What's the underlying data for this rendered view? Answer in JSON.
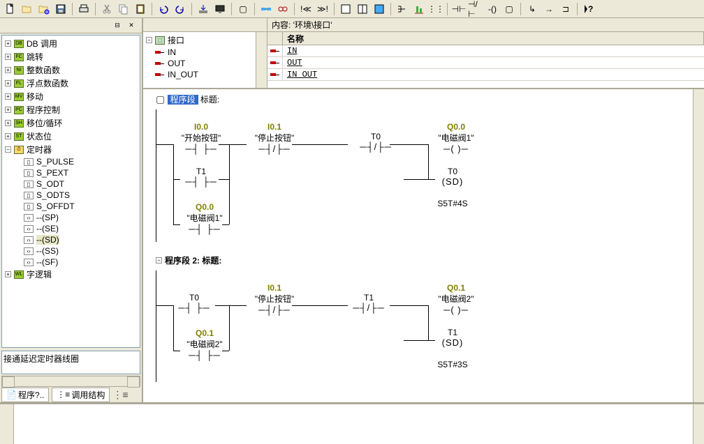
{
  "content_bar_label": "内容: '环境\\接口'",
  "interface_header": {
    "name": "名称"
  },
  "interface_tree_root": "接口",
  "interface_items": [
    {
      "name": "IN"
    },
    {
      "name": "OUT"
    },
    {
      "name": "IN_OUT"
    }
  ],
  "interface_table_rows": [
    "IN",
    "OUT",
    "IN OUT"
  ],
  "left_tree": {
    "groups": [
      {
        "label": "DB 调用",
        "icon": "DB"
      },
      {
        "label": "跳转",
        "icon": "FC"
      },
      {
        "label": "整数函数",
        "icon": "NI"
      },
      {
        "label": "浮点数函数",
        "icon": "FL"
      },
      {
        "label": "移动",
        "icon": "MV"
      },
      {
        "label": "程序控制",
        "icon": "PC"
      },
      {
        "label": "移位/循环",
        "icon": "SH"
      },
      {
        "label": "状态位",
        "icon": "ST"
      }
    ],
    "timer_group": "定时器",
    "timer_items": [
      "S_PULSE",
      "S_PEXT",
      "S_ODT",
      "S_ODTS",
      "S_OFFDT",
      "--(SP)",
      "--(SE)",
      "--(SD)",
      "--(SS)",
      "--(SF)"
    ],
    "selected_timer": "--(SD)",
    "last_group": "字逻辑"
  },
  "status_text": "接通延迟定时器线圈",
  "tabs": {
    "program": "程序?..",
    "structure": "调用结构"
  },
  "ladder": {
    "rung1": {
      "contacts": [
        {
          "addr": "I0.0",
          "label": "\"开始按钮\"",
          "sym": "┤├"
        },
        {
          "addr": "I0.1",
          "label": "\"停止按钮\"",
          "sym": "┤/├"
        },
        {
          "addr": "",
          "label": "T0",
          "sym": "┤/├"
        },
        {
          "addr": "Q0.0",
          "label": "\"电磁阀1\"",
          "sym": "( )"
        }
      ],
      "branch1": {
        "label": "T1",
        "sym": "┤├"
      },
      "branch2": {
        "addr": "Q0.0",
        "label": "\"电磁阀1\"",
        "sym": "┤├"
      },
      "timer": {
        "label": "T0",
        "sym": "(SD)",
        "time": "S5T#4S"
      }
    },
    "segment2_title": "程序段 2: 标题:",
    "rung2": {
      "contacts": [
        {
          "addr": "",
          "label": "T0",
          "sym": "┤├"
        },
        {
          "addr": "I0.1",
          "label": "\"停止按钮\"",
          "sym": "┤/├"
        },
        {
          "addr": "",
          "label": "T1",
          "sym": "┤/├"
        },
        {
          "addr": "Q0.1",
          "label": "\"电磁阀2\"",
          "sym": "( )"
        }
      ],
      "branch": {
        "addr": "Q0.1",
        "label": "\"电磁阀2\"",
        "sym": "┤├"
      },
      "timer": {
        "label": "T1",
        "sym": "(SD)",
        "time": "S5T#3S"
      }
    }
  }
}
